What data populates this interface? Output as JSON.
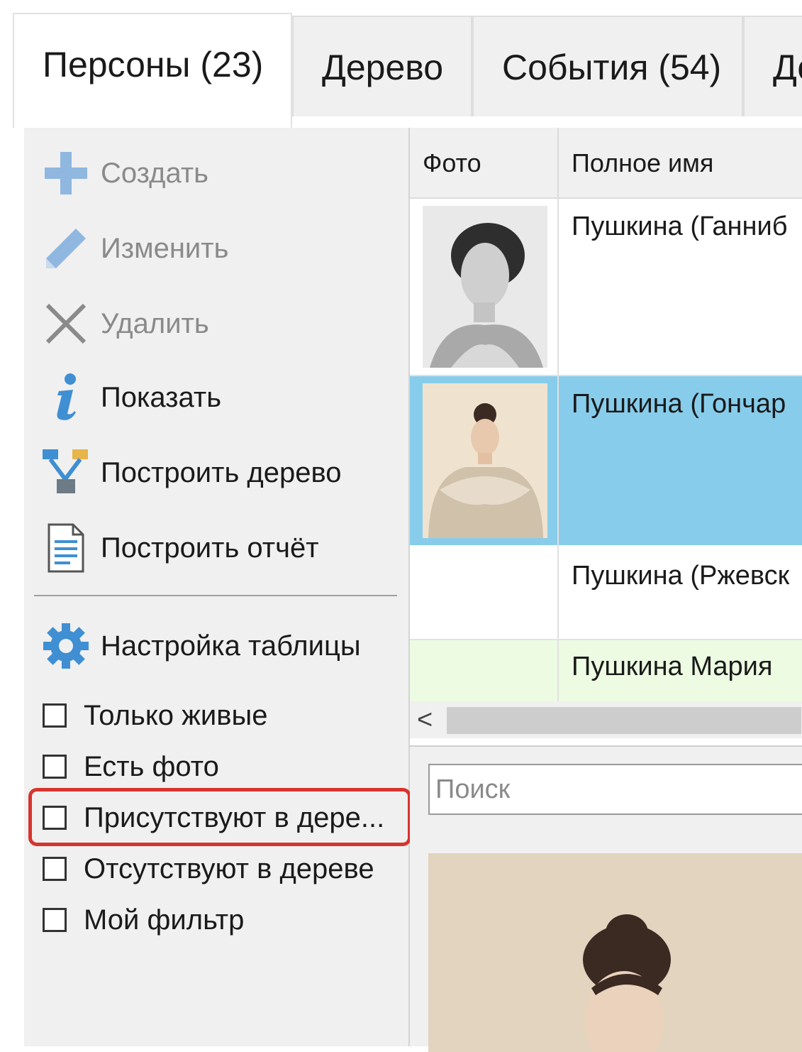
{
  "tabs": [
    {
      "label": "Персоны (23)",
      "active": true
    },
    {
      "label": "Дерево",
      "active": false
    },
    {
      "label": "События (54)",
      "active": false
    },
    {
      "label": "Документы",
      "active": false
    }
  ],
  "actions": [
    {
      "label": "Создать",
      "icon": "plus-icon",
      "enabled": false
    },
    {
      "label": "Изменить",
      "icon": "pencil-icon",
      "enabled": false
    },
    {
      "label": "Удалить",
      "icon": "delete-x-icon",
      "enabled": false
    },
    {
      "label": "Показать",
      "icon": "info-icon",
      "enabled": true
    },
    {
      "label": "Построить дерево",
      "icon": "tree-icon",
      "enabled": true
    },
    {
      "label": "Построить отчёт",
      "icon": "report-document-icon",
      "enabled": true
    },
    {
      "label": "Настройка таблицы",
      "icon": "gear-icon",
      "enabled": true
    }
  ],
  "filters": [
    {
      "label": "Только живые",
      "checked": false
    },
    {
      "label": "Есть фото",
      "checked": false
    },
    {
      "label": "Присутствуют в дере...",
      "checked": false,
      "highlighted": true
    },
    {
      "label": "Отсутствуют в дереве",
      "checked": false
    },
    {
      "label": "Мой фильтр",
      "checked": false
    }
  ],
  "grid": {
    "columns": [
      "Фото",
      "Полное имя"
    ],
    "rows": [
      {
        "name": "Пушкина (Ганниб",
        "has_photo": true,
        "selected": false
      },
      {
        "name": "Пушкина (Гончар",
        "has_photo": true,
        "selected": true
      },
      {
        "name": "Пушкина (Ржевск",
        "has_photo": false,
        "selected": false
      },
      {
        "name": "Пушкина Мария",
        "has_photo": false,
        "selected": false,
        "tint": "#ecfbe2"
      }
    ],
    "scroll_left_glyph": "<"
  },
  "search": {
    "placeholder": "Поиск",
    "value": ""
  },
  "colors": {
    "selected_row": "#87cdeb",
    "highlight_border": "#d7342e",
    "icon_blue": "#3f8fd2",
    "icon_disabled": "#8fb7df"
  }
}
